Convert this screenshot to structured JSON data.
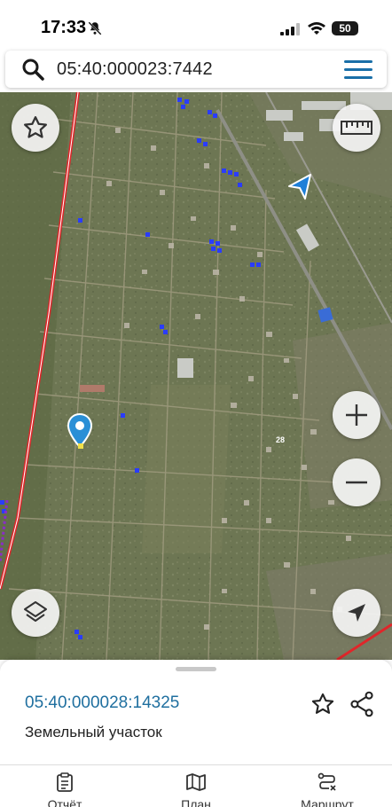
{
  "status_bar": {
    "time": "17:33",
    "battery": "50",
    "icons": [
      "bell-off-icon",
      "cellular-signal-icon",
      "wifi-icon",
      "battery-icon"
    ]
  },
  "search": {
    "query": "05:40:000023:7442",
    "icons": [
      "search-icon",
      "menu-icon"
    ]
  },
  "map": {
    "label_text": "28",
    "controls": [
      "favorite-star",
      "ruler",
      "zoom-in",
      "zoom-out",
      "layers",
      "my-location"
    ],
    "colors": {
      "boundary_line": "#e0262a",
      "pin": "#2a8fd6",
      "parcel_marks": "#2a3cff",
      "location_arrow": "#1e7fd8"
    }
  },
  "sheet": {
    "parcel_number": "05:40:000028:14325",
    "parcel_type": "Земельный участок",
    "icons": [
      "star-outline-icon",
      "share-icon"
    ]
  },
  "tabbar": {
    "tabs": [
      {
        "label": "Отчёт",
        "icon": "report-clipboard-icon"
      },
      {
        "label": "План",
        "icon": "map-plan-icon"
      },
      {
        "label": "Маршрут",
        "icon": "route-icon"
      }
    ]
  }
}
